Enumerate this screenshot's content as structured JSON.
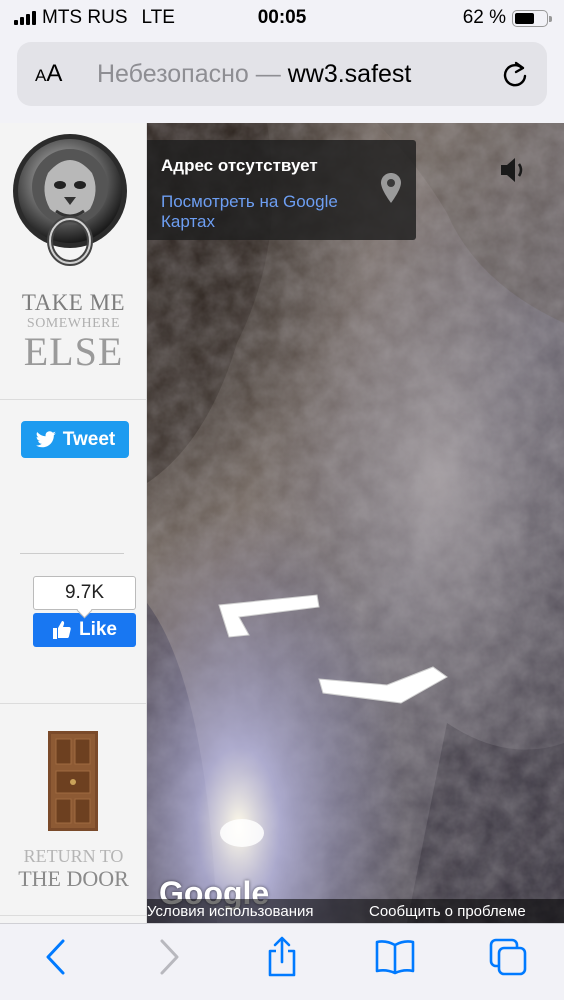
{
  "status_bar": {
    "carrier": "MTS RUS",
    "network": "LTE",
    "time": "00:05",
    "battery_text": "62 %",
    "battery_level_percent": 62
  },
  "address_bar": {
    "aa_label_small": "A",
    "aa_label_large": "A",
    "security": "Небезопасно —",
    "domain": "ww3.safest",
    "reload_icon": "reload-icon"
  },
  "sidebar": {
    "logo_icon": "lion-knocker-icon",
    "take_me": {
      "line1": "TAKE ME",
      "line2": "SOMEWHERE",
      "line3": "ELSE"
    },
    "tweet_label": "Tweet",
    "like_count": "9.7K",
    "like_label": "Like",
    "door_icon": "door-icon",
    "return": {
      "line1": "RETURN TO",
      "line2": "THE DOOR"
    }
  },
  "street_view": {
    "address_title": "Адрес отсутствует",
    "maps_link": "Посмотреть на Google Картах",
    "google_logo": "Google",
    "terms": "Условия использования",
    "report": "Сообщить о проблеме"
  },
  "toolbar": {
    "icons": [
      "back-icon",
      "forward-icon",
      "share-icon",
      "bookmarks-icon",
      "tabs-icon"
    ]
  },
  "colors": {
    "accent": "#007aff",
    "tweet": "#1d9bf0",
    "like": "#1877f2",
    "link": "#6d9ef2"
  }
}
